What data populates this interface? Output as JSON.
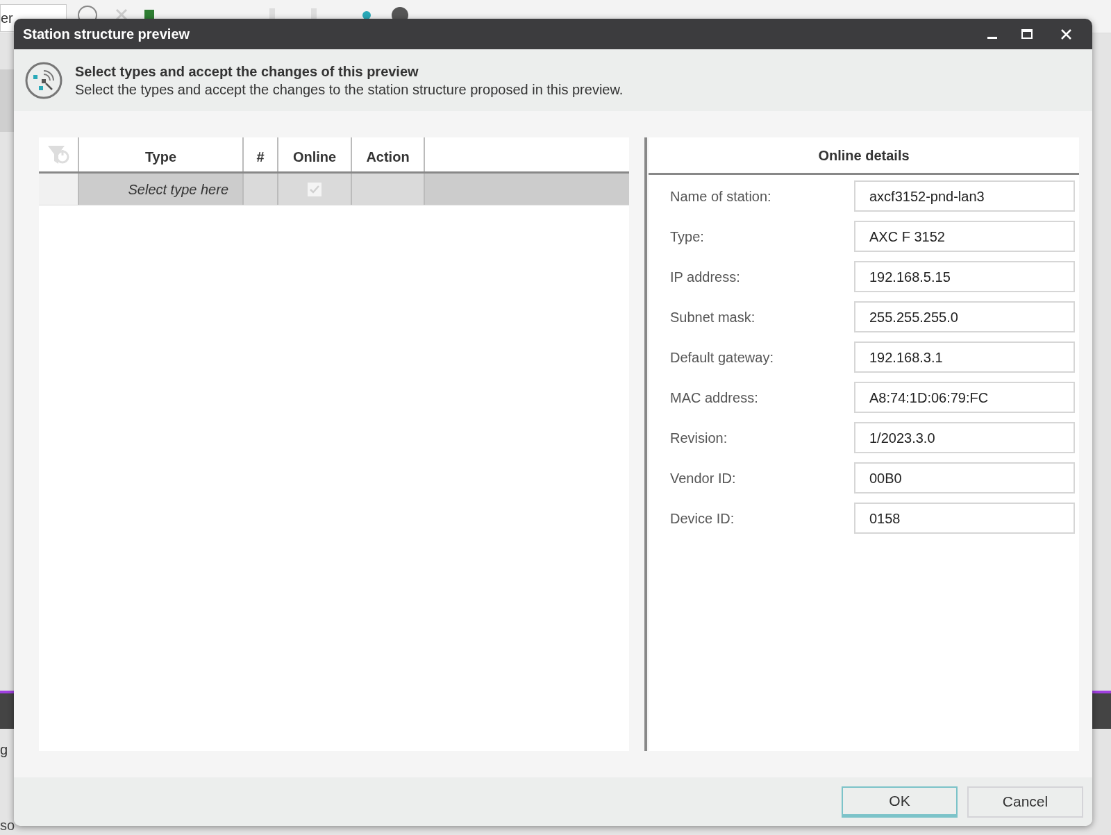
{
  "background": {
    "dropdown_text": "er",
    "side_text": "g",
    "status_text": "so"
  },
  "window": {
    "title": "Station structure preview"
  },
  "header": {
    "title": "Select types and accept the changes of this preview",
    "description": "Select the types and accept the changes to the station structure proposed in this preview."
  },
  "table": {
    "columns": [
      "Type",
      "#",
      "Online",
      "Action"
    ],
    "rows": [
      {
        "type_placeholder": "Select type here",
        "online": true
      }
    ]
  },
  "details": {
    "title": "Online details",
    "fields": [
      {
        "label": "Name of station:",
        "value": "axcf3152-pnd-lan3"
      },
      {
        "label": "Type:",
        "value": "AXC F 3152"
      },
      {
        "label": "IP address:",
        "value": "192.168.5.15"
      },
      {
        "label": "Subnet mask:",
        "value": "255.255.255.0"
      },
      {
        "label": "Default gateway:",
        "value": "192.168.3.1"
      },
      {
        "label": "MAC address:",
        "value": "A8:74:1D:06:79:FC"
      },
      {
        "label": "Revision:",
        "value": "1/2023.3.0"
      },
      {
        "label": "Vendor ID:",
        "value": "00B0"
      },
      {
        "label": "Device ID:",
        "value": "0158"
      }
    ]
  },
  "buttons": [
    {
      "label": "OK",
      "kind": "primary"
    },
    {
      "label": "Cancel",
      "kind": "secondary"
    }
  ]
}
